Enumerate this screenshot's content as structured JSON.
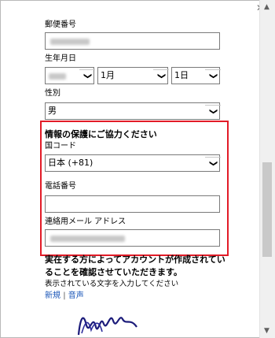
{
  "close_icon": "close-icon",
  "fields": {
    "postal_code": {
      "label": "郵便番号"
    },
    "birthdate": {
      "label": "生年月日",
      "month": "1月",
      "day": "1日"
    },
    "gender": {
      "label": "性別",
      "value": "男"
    }
  },
  "privacy_section": {
    "title": "情報の保護にご協力ください",
    "country_code_label": "国コード",
    "country_code_value": "日本 (+81)",
    "phone_label": "電話番号",
    "email_label": "連絡用メール アドレス"
  },
  "captcha": {
    "notice": "実在する方によってアカウントが作成されていることを確認させていただきます。",
    "instruction": "表示されている文字を入力してください",
    "new_link": "新規",
    "separator": "|",
    "audio_link": "音声"
  },
  "colors": {
    "highlight_border": "#e21b27",
    "link": "#1a56b8"
  }
}
